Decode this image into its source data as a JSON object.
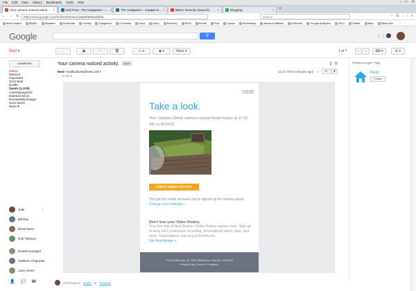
{
  "window": {
    "menu": [
      "File",
      "Edit",
      "View",
      "History",
      "Bookmarks",
      "Tools",
      "Help"
    ]
  },
  "tabs": [
    {
      "label": "Your camera noticed activit...",
      "color": "#d14836",
      "active": true
    },
    {
      "label": "Edit Post ‹ The Gadgeteer —...",
      "color": "#21759b",
      "active": false
    },
    {
      "label": "The Gadgeteer – Gadget re...",
      "color": "#21759b",
      "active": false
    },
    {
      "label": "BBHC Remedy (Search)",
      "color": "#d14836",
      "active": false
    },
    {
      "label": "Blogging",
      "color": "#34a853",
      "active": false
    }
  ],
  "address": {
    "url": "https://mail.google.com/mail/u/0/#inbox/15689f68ba3f6f05",
    "search_placeholder": "Search"
  },
  "bookmarks": [
    "Most Visited",
    "BMAIL",
    "Weather",
    "HootSuite",
    "Feedly",
    "Gadgeteer",
    "Cummins",
    "Docs",
    "Keep",
    "Remedy",
    "RDM",
    "Elome",
    "Pod",
    "Canva",
    "PicMonkey",
    "Amazon Affiliate",
    "AdSense",
    "Google Analytics",
    "OKO",
    "Twitter",
    "Misc",
    "Read this"
  ],
  "gmail": {
    "logo": "Google",
    "mail_label": "Mail ▾",
    "compose": "COMPOSE",
    "pager": "1 of 7",
    "more": "More ▾"
  },
  "labels": [
    {
      "name": "Inbox",
      "state": "sel"
    },
    {
      "name": "Starred",
      "state": ""
    },
    {
      "name": "Important",
      "state": ""
    },
    {
      "name": "Sent Mail",
      "state": ""
    },
    {
      "name": "Drafts",
      "state": ""
    },
    {
      "name": "Spam (1,315)",
      "state": "bold"
    },
    {
      "name": "Advertising/GIG",
      "state": ""
    },
    {
      "name": "Deleted Items",
      "state": ""
    },
    {
      "name": "Review/MyCharge",
      "state": ""
    },
    {
      "name": "Sent Items",
      "state": ""
    },
    {
      "name": "More ▾",
      "state": ""
    }
  ],
  "hangouts": {
    "me": "Julie",
    "contacts": [
      "Bill Ray",
      "David Rees",
      "Rob Tillotson",
      "brownrcountygirl",
      "Kathleen Chapman",
      "Larry Gerez"
    ]
  },
  "message": {
    "subject": "Your camera noticed activity.",
    "chip": "Inbox",
    "sender": "Nest",
    "sender_email": "<notifications@nest.com>",
    "to": "to me",
    "time": "11:32 AM (4 minutes ago)"
  },
  "email": {
    "logo": "nest",
    "headline": "Take a look.",
    "notice": "Your Upstairs (Reid) camera noticed Road motion at 11:32 AM on 8/19/16.",
    "cta": "CHECK VIDEO HISTORY",
    "why": "You got this email because you're signed up for camera alerts.",
    "change_settings": "Change your settings »",
    "lose_title": "Don't lose your Video History.",
    "lose_body": "Your free trial of Nest Aware + Video History expires soon. Sign up to keep 24/7 continuous recording, personalized alerts, clips, and more. Subscriptions start at just $10/month.",
    "lose_link": "Get Nest Aware »",
    "footer_address": "© 2016 Nest Labs, Inc. 3400 Hillview Ave, Palo Alto, CA 94304",
    "footer_links": "Privacy Policy  |  Terms & Conditions"
  },
  "reply_row": {
    "click": "Click here to",
    "reply": "Reply",
    "or": "or",
    "forward": "Forward"
  },
  "right_panel": {
    "title": "Related Google+ Page",
    "name": "Nest",
    "follow": "Follow"
  }
}
